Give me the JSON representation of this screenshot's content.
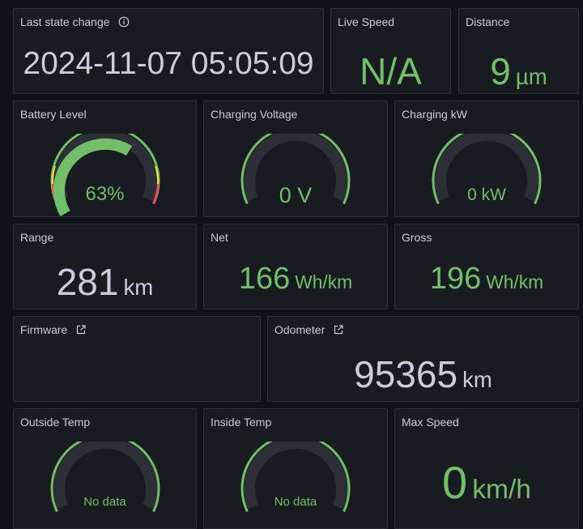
{
  "colors": {
    "background": "#111217",
    "panel": "#181b1f",
    "border": "#2d3035",
    "green": "#73bf69",
    "text": "#ccccdc",
    "track": "#2c2f35",
    "red": "#f2495c",
    "yellow": "#fade2a"
  },
  "panels": {
    "last_state_change": {
      "title": "Last state change",
      "info_icon": "info-icon",
      "value": "2024-11-07 05:05:09"
    },
    "live_speed": {
      "title": "Live Speed",
      "value": "N/A"
    },
    "distance": {
      "title": "Distance",
      "value": "9",
      "unit": "µm"
    },
    "battery_level": {
      "title": "Battery Level",
      "value": "63%",
      "level": 0.63
    },
    "charging_voltage": {
      "title": "Charging Voltage",
      "value": "0 V",
      "level": 0
    },
    "charging_kw": {
      "title": "Charging kW",
      "value": "0 kW",
      "level": 0
    },
    "range": {
      "title": "Range",
      "value": "281",
      "unit": "km"
    },
    "net": {
      "title": "Net",
      "value": "166",
      "unit": "Wh/km"
    },
    "gross": {
      "title": "Gross",
      "value": "196",
      "unit": "Wh/km"
    },
    "firmware": {
      "title": "Firmware",
      "link_icon": "external-link-icon"
    },
    "odometer": {
      "title": "Odometer",
      "link_icon": "external-link-icon",
      "value": "95365",
      "unit": "km"
    },
    "outside_temp": {
      "title": "Outside Temp",
      "value": "No data"
    },
    "inside_temp": {
      "title": "Inside Temp",
      "value": "No data"
    },
    "max_speed": {
      "title": "Max Speed",
      "value": "0",
      "unit": "km/h"
    }
  }
}
